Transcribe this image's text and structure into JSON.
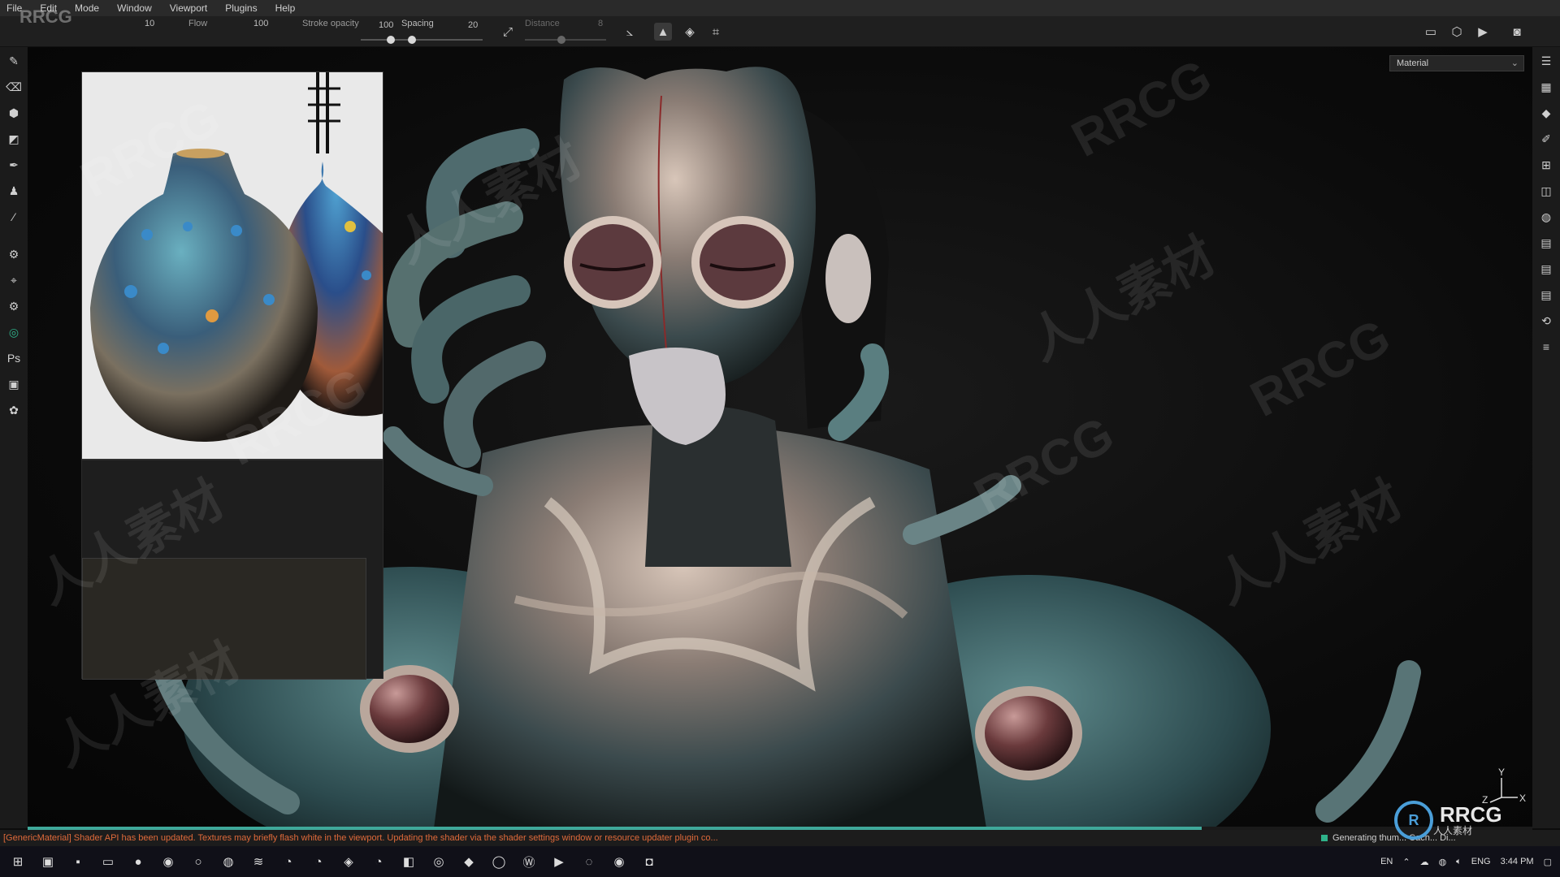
{
  "menu": [
    "File",
    "Edit",
    "Mode",
    "Window",
    "Viewport",
    "Plugins",
    "Help"
  ],
  "toolbar": {
    "size_value": "10",
    "flow_label": "Flow",
    "flow_value": "100",
    "stroke_opacity_label": "Stroke opacity",
    "stroke_opacity_value": "100",
    "spacing_label": "Spacing",
    "spacing_value": "20",
    "distance_label": "Distance",
    "distance_value": "8"
  },
  "viewport": {
    "shading_mode": "Material",
    "axis_y": "Y",
    "axis_z": "Z",
    "axis_x": "X",
    "watermarks": [
      "RRCG",
      "人人素材",
      "RRCG",
      "人人素材",
      "RRCG",
      "人人素材",
      "RRCG",
      "人人素材",
      "RRCG",
      "人人素材"
    ],
    "corner_mark": "RRCG"
  },
  "progress": {
    "fraction": 0.78
  },
  "status": {
    "message": "[GenericMaterial] Shader API has been updated. Textures may briefly flash white in the viewport. Updating the shader via the shader settings window or resource updater plugin co...",
    "right": "Generating thum...   Cach... Di..."
  },
  "taskbar": {
    "lang1": "EN",
    "lang2": "ENG",
    "time": "3:44 PM"
  },
  "logo": {
    "name": "RRCG",
    "sub": "人人素材"
  }
}
